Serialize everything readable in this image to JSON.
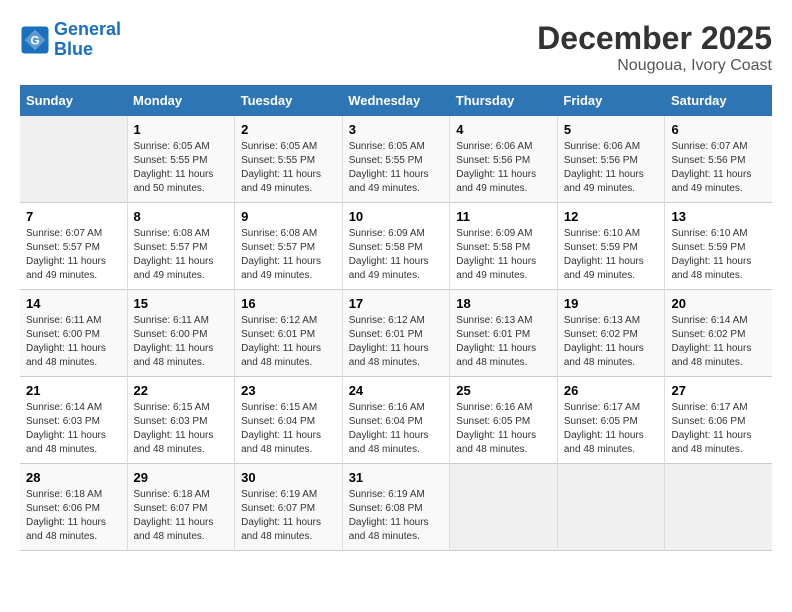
{
  "logo": {
    "line1": "General",
    "line2": "Blue"
  },
  "title": "December 2025",
  "subtitle": "Nougoua, Ivory Coast",
  "header_days": [
    "Sunday",
    "Monday",
    "Tuesday",
    "Wednesday",
    "Thursday",
    "Friday",
    "Saturday"
  ],
  "weeks": [
    [
      {
        "day": "",
        "info": ""
      },
      {
        "day": "1",
        "info": "Sunrise: 6:05 AM\nSunset: 5:55 PM\nDaylight: 11 hours\nand 50 minutes."
      },
      {
        "day": "2",
        "info": "Sunrise: 6:05 AM\nSunset: 5:55 PM\nDaylight: 11 hours\nand 49 minutes."
      },
      {
        "day": "3",
        "info": "Sunrise: 6:05 AM\nSunset: 5:55 PM\nDaylight: 11 hours\nand 49 minutes."
      },
      {
        "day": "4",
        "info": "Sunrise: 6:06 AM\nSunset: 5:56 PM\nDaylight: 11 hours\nand 49 minutes."
      },
      {
        "day": "5",
        "info": "Sunrise: 6:06 AM\nSunset: 5:56 PM\nDaylight: 11 hours\nand 49 minutes."
      },
      {
        "day": "6",
        "info": "Sunrise: 6:07 AM\nSunset: 5:56 PM\nDaylight: 11 hours\nand 49 minutes."
      }
    ],
    [
      {
        "day": "7",
        "info": "Sunrise: 6:07 AM\nSunset: 5:57 PM\nDaylight: 11 hours\nand 49 minutes."
      },
      {
        "day": "8",
        "info": "Sunrise: 6:08 AM\nSunset: 5:57 PM\nDaylight: 11 hours\nand 49 minutes."
      },
      {
        "day": "9",
        "info": "Sunrise: 6:08 AM\nSunset: 5:57 PM\nDaylight: 11 hours\nand 49 minutes."
      },
      {
        "day": "10",
        "info": "Sunrise: 6:09 AM\nSunset: 5:58 PM\nDaylight: 11 hours\nand 49 minutes."
      },
      {
        "day": "11",
        "info": "Sunrise: 6:09 AM\nSunset: 5:58 PM\nDaylight: 11 hours\nand 49 minutes."
      },
      {
        "day": "12",
        "info": "Sunrise: 6:10 AM\nSunset: 5:59 PM\nDaylight: 11 hours\nand 49 minutes."
      },
      {
        "day": "13",
        "info": "Sunrise: 6:10 AM\nSunset: 5:59 PM\nDaylight: 11 hours\nand 48 minutes."
      }
    ],
    [
      {
        "day": "14",
        "info": "Sunrise: 6:11 AM\nSunset: 6:00 PM\nDaylight: 11 hours\nand 48 minutes."
      },
      {
        "day": "15",
        "info": "Sunrise: 6:11 AM\nSunset: 6:00 PM\nDaylight: 11 hours\nand 48 minutes."
      },
      {
        "day": "16",
        "info": "Sunrise: 6:12 AM\nSunset: 6:01 PM\nDaylight: 11 hours\nand 48 minutes."
      },
      {
        "day": "17",
        "info": "Sunrise: 6:12 AM\nSunset: 6:01 PM\nDaylight: 11 hours\nand 48 minutes."
      },
      {
        "day": "18",
        "info": "Sunrise: 6:13 AM\nSunset: 6:01 PM\nDaylight: 11 hours\nand 48 minutes."
      },
      {
        "day": "19",
        "info": "Sunrise: 6:13 AM\nSunset: 6:02 PM\nDaylight: 11 hours\nand 48 minutes."
      },
      {
        "day": "20",
        "info": "Sunrise: 6:14 AM\nSunset: 6:02 PM\nDaylight: 11 hours\nand 48 minutes."
      }
    ],
    [
      {
        "day": "21",
        "info": "Sunrise: 6:14 AM\nSunset: 6:03 PM\nDaylight: 11 hours\nand 48 minutes."
      },
      {
        "day": "22",
        "info": "Sunrise: 6:15 AM\nSunset: 6:03 PM\nDaylight: 11 hours\nand 48 minutes."
      },
      {
        "day": "23",
        "info": "Sunrise: 6:15 AM\nSunset: 6:04 PM\nDaylight: 11 hours\nand 48 minutes."
      },
      {
        "day": "24",
        "info": "Sunrise: 6:16 AM\nSunset: 6:04 PM\nDaylight: 11 hours\nand 48 minutes."
      },
      {
        "day": "25",
        "info": "Sunrise: 6:16 AM\nSunset: 6:05 PM\nDaylight: 11 hours\nand 48 minutes."
      },
      {
        "day": "26",
        "info": "Sunrise: 6:17 AM\nSunset: 6:05 PM\nDaylight: 11 hours\nand 48 minutes."
      },
      {
        "day": "27",
        "info": "Sunrise: 6:17 AM\nSunset: 6:06 PM\nDaylight: 11 hours\nand 48 minutes."
      }
    ],
    [
      {
        "day": "28",
        "info": "Sunrise: 6:18 AM\nSunset: 6:06 PM\nDaylight: 11 hours\nand 48 minutes."
      },
      {
        "day": "29",
        "info": "Sunrise: 6:18 AM\nSunset: 6:07 PM\nDaylight: 11 hours\nand 48 minutes."
      },
      {
        "day": "30",
        "info": "Sunrise: 6:19 AM\nSunset: 6:07 PM\nDaylight: 11 hours\nand 48 minutes."
      },
      {
        "day": "31",
        "info": "Sunrise: 6:19 AM\nSunset: 6:08 PM\nDaylight: 11 hours\nand 48 minutes."
      },
      {
        "day": "",
        "info": ""
      },
      {
        "day": "",
        "info": ""
      },
      {
        "day": "",
        "info": ""
      }
    ]
  ]
}
